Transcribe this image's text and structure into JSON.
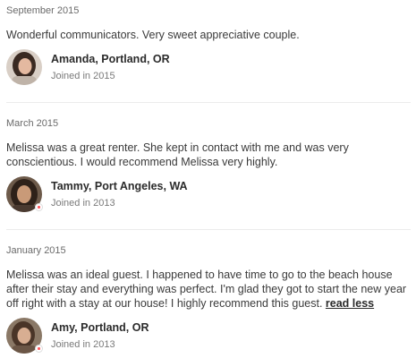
{
  "reviews": [
    {
      "date": "September 2015",
      "text": "Wonderful communicators. Very sweet appreciative couple.",
      "author": "Amanda, Portland, OR",
      "joined": "Joined in 2015",
      "avatar_colors": {
        "bg": "#d9cfc6",
        "hair": "#3a2a22",
        "skin": "#e4b9a0"
      }
    },
    {
      "date": "March 2015",
      "text": "Melissa was a great renter. She kept in contact with me and was very conscientious. I would recommend Melissa very highly.",
      "author": "Tammy, Port Angeles, WA",
      "joined": "Joined in 2013",
      "avatar_colors": {
        "bg": "#6d5a4a",
        "hair": "#2e2119",
        "skin": "#c99a78"
      }
    },
    {
      "date": "January 2015",
      "text": "Melissa was an ideal guest. I happened to have time to go to the beach house after their stay and everything was perfect. I'm glad they got to start the new year off right with a stay at our house! I highly recommend this guest. ",
      "read_less": "read less",
      "author": "Amy, Portland, OR",
      "joined": "Joined in 2013",
      "avatar_colors": {
        "bg": "#8a7866",
        "hair": "#4a3528",
        "skin": "#d8ae92"
      }
    }
  ]
}
